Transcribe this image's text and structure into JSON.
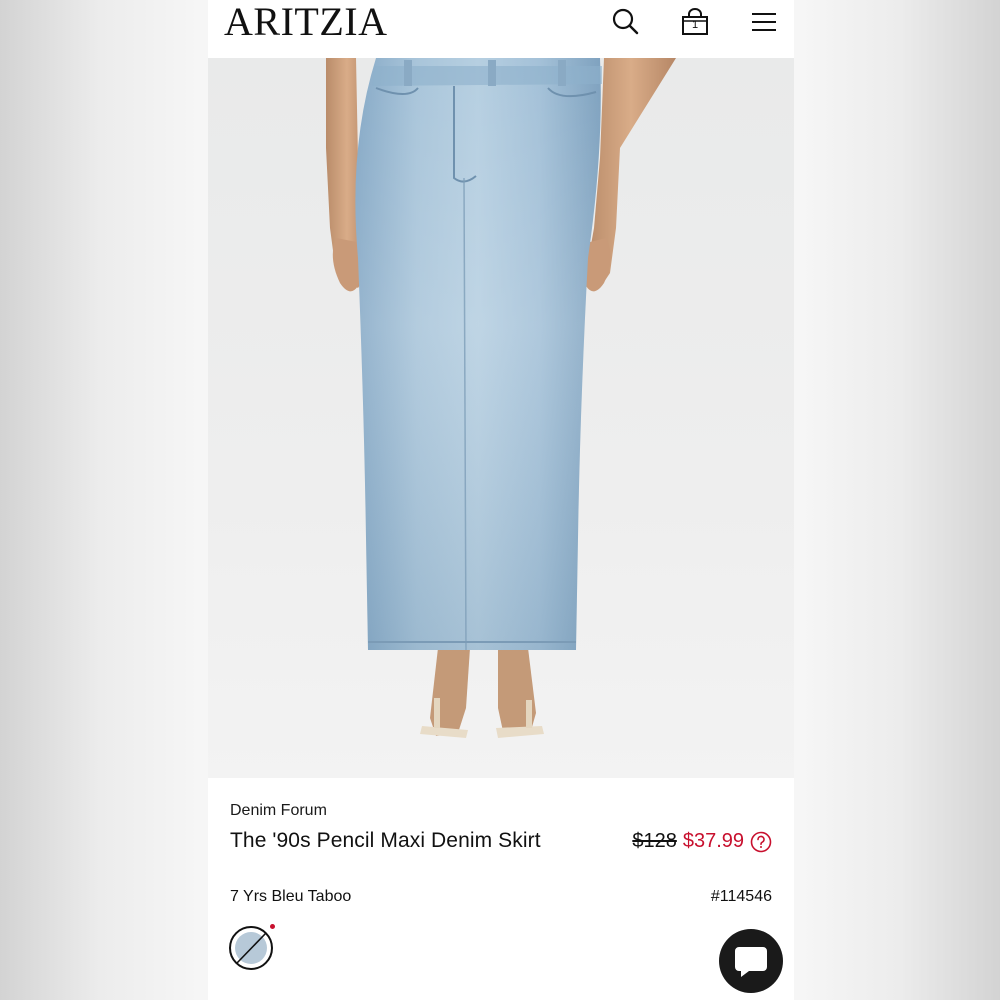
{
  "header": {
    "logo": "ARITZIA",
    "bag_count": "1"
  },
  "icons": {
    "search": "search-icon",
    "bag": "shopping-bag-icon",
    "menu": "hamburger-menu-icon",
    "help": "question-circle-icon",
    "chat": "chat-bubble-icon"
  },
  "product": {
    "brand": "Denim Forum",
    "title": "The '90s Pencil Maxi Denim Skirt",
    "price_original": "$128",
    "price_sale": "$37.99",
    "color_name": "7 Yrs Bleu Taboo",
    "sku": "#114546"
  },
  "colors": {
    "sale": "#c8102e",
    "denim": "#9ebfd7",
    "swatch": "#b7c9d8"
  }
}
